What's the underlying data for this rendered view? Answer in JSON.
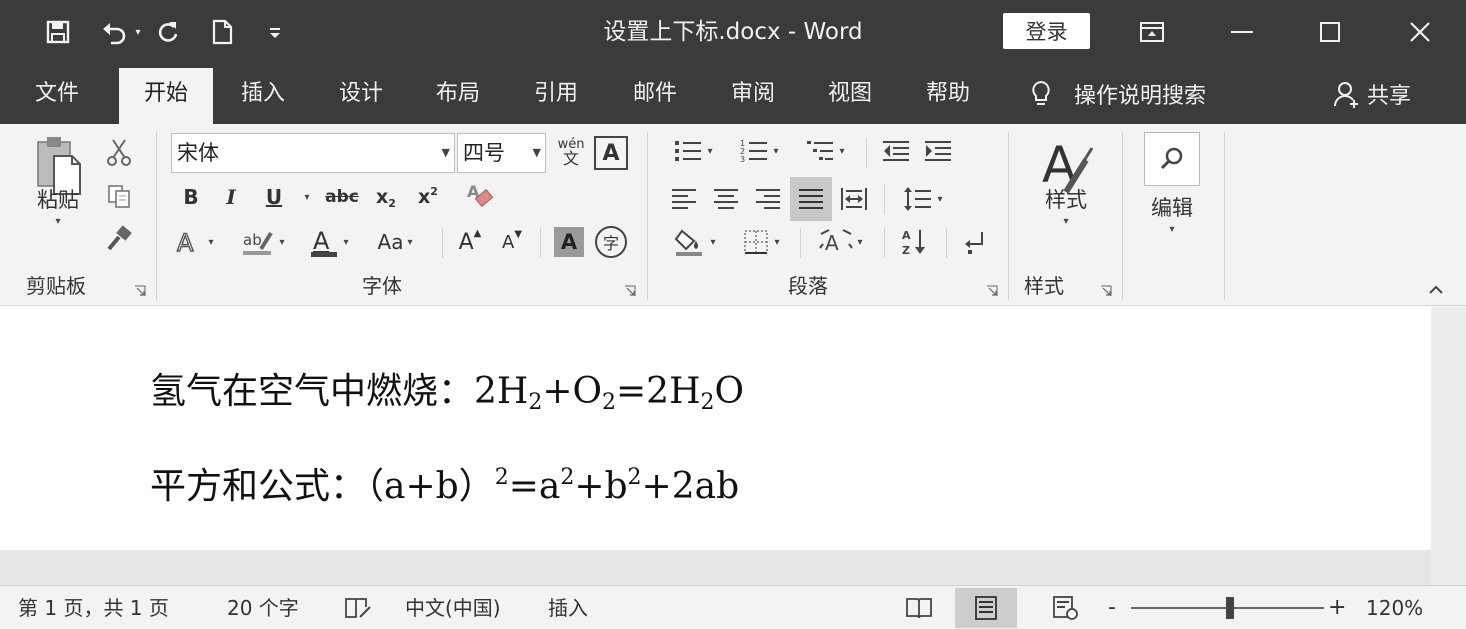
{
  "title_bar": {
    "document_title": "设置上下标.docx  -  Word",
    "login_label": "登录",
    "qat_icons": [
      "save-icon",
      "undo-icon",
      "redo-icon",
      "new-document-icon",
      "customize-qat-icon"
    ],
    "window_icons": [
      "ribbon-display-options-icon",
      "minimize-icon",
      "maximize-icon",
      "close-icon"
    ]
  },
  "tabs": {
    "items": [
      "文件",
      "开始",
      "插入",
      "设计",
      "布局",
      "引用",
      "邮件",
      "审阅",
      "视图",
      "帮助"
    ],
    "active": "开始",
    "tell_me": "操作说明搜索",
    "share": "共享"
  },
  "ribbon": {
    "clipboard": {
      "label": "剪贴板",
      "paste_label": "粘贴"
    },
    "font": {
      "label": "字体",
      "font_name": "宋体",
      "font_size": "四号",
      "phonetic_label": "wén",
      "phonetic_char": "文",
      "enclosed_char": "A",
      "bold": "B",
      "italic": "I",
      "underline": "U",
      "strikethrough": "abc",
      "subscript": "x",
      "subscript_mark": "2",
      "superscript": "x",
      "superscript_mark": "2",
      "change_case": "Aa",
      "grow_font": "A",
      "shrink_font": "A",
      "char_shading": "A",
      "enclose_char": "字"
    },
    "paragraph": {
      "label": "段落"
    },
    "styles": {
      "label": "样式",
      "button_label": "样式"
    },
    "editing": {
      "button_label": "编辑"
    }
  },
  "document": {
    "line1": {
      "prefix": "氢气在空气中燃烧：",
      "parts": [
        "2H",
        "2",
        "+O",
        "2",
        "=2H",
        "2",
        "O"
      ]
    },
    "line2": {
      "prefix": "平方和公式：（a+b）",
      "parts": [
        "2",
        "=a",
        "2",
        "+b",
        "2",
        "+2ab"
      ]
    }
  },
  "status_bar": {
    "page_info": "第 1 页，共 1 页",
    "word_count": "20 个字",
    "language": "中文(中国)",
    "mode": "插入",
    "zoom_minus": "-",
    "zoom_plus": "+",
    "zoom_level": "120%"
  },
  "colors": {
    "title_bar_bg": "#3b3b3b",
    "ribbon_bg": "#f3f3f3",
    "page_bg": "#ffffff"
  }
}
